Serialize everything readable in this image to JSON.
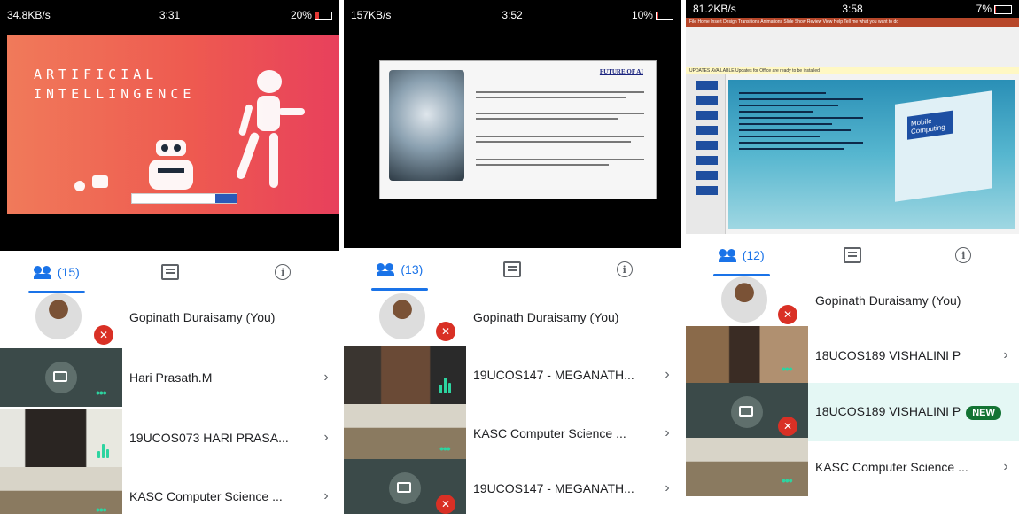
{
  "phones": [
    {
      "status": {
        "left": "34.8KB/s",
        "time": "3:31",
        "battery": "20%"
      },
      "tabs": {
        "people": "(15)"
      },
      "slide": {
        "title_line1": "ARTIFICIAL",
        "title_line2": "INTELLINGENCE"
      },
      "participants": [
        {
          "name": "Gopinath Duraisamy (You)"
        },
        {
          "name": "Hari Prasath.M"
        },
        {
          "name": "19UCOS073 HARI PRASA..."
        },
        {
          "name": "KASC Computer Science ..."
        }
      ]
    },
    {
      "status": {
        "left": "157KB/s",
        "time": "3:52",
        "battery": "10%"
      },
      "tabs": {
        "people": "(13)"
      },
      "slide": {
        "title": "FUTURE OF AI"
      },
      "participants": [
        {
          "name": "Gopinath Duraisamy (You)"
        },
        {
          "name": "19UCOS147 - MEGANATH..."
        },
        {
          "name": "KASC Computer Science ..."
        },
        {
          "name": "19UCOS147 - MEGANATH..."
        }
      ]
    },
    {
      "status": {
        "left": "81.2KB/s",
        "time": "3:58",
        "battery": "7%"
      },
      "tabs": {
        "people": "(12)"
      },
      "slide": {
        "ribbon": "File  Home  Insert  Design  Transitions  Animations  Slide Show  Review  View  Help  Tell me what you want to do",
        "update": "UPDATES AVAILABLE  Updates for Office are ready to be installed",
        "graphic": "Mobile Computing"
      },
      "participants": [
        {
          "name": "Gopinath Duraisamy (You)"
        },
        {
          "name": "18UCOS189 VISHALINI P"
        },
        {
          "name": "18UCOS189 VISHALINI P",
          "badge": "NEW"
        },
        {
          "name": "KASC Computer Science ..."
        }
      ]
    }
  ],
  "colors": {
    "accent": "#1a73e8",
    "mute": "#d93025",
    "new_badge": "#137333",
    "talking": "#2dd4a0"
  },
  "icons": {
    "people": "people-icon",
    "chat": "chat-icon",
    "info": "info-icon",
    "chevron": "chevron-right-icon",
    "mic_off": "mic-off-icon",
    "present": "present-screen-icon"
  }
}
